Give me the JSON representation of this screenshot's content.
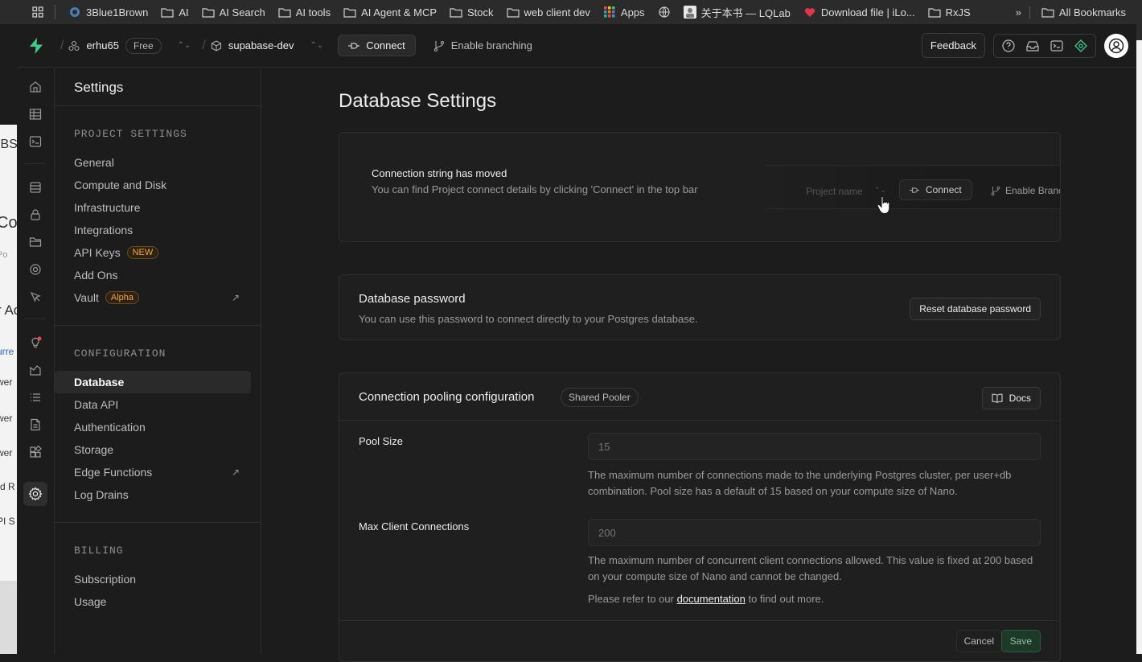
{
  "bookmarks": {
    "items": [
      {
        "label": "3Blue1Brown",
        "icon": "3b1b-icon"
      },
      {
        "label": "AI",
        "icon": "folder-icon"
      },
      {
        "label": "AI Search",
        "icon": "folder-icon"
      },
      {
        "label": "AI tools",
        "icon": "folder-icon"
      },
      {
        "label": "AI Agent & MCP",
        "icon": "folder-icon"
      },
      {
        "label": "Stock",
        "icon": "folder-icon"
      },
      {
        "label": "web client dev",
        "icon": "folder-icon"
      },
      {
        "label": "Apps",
        "icon": "apps-grid-icon"
      },
      {
        "label": "",
        "icon": "globe-icon"
      },
      {
        "label": "关于本书 — LQLab",
        "icon": "avatar-icon"
      },
      {
        "label": "Download file | iLo...",
        "icon": "heart-icon"
      },
      {
        "label": "RxJS",
        "icon": "folder-icon"
      }
    ],
    "more": "»",
    "all": "All Bookmarks"
  },
  "background": {
    "fragments": [
      "IBS",
      "Co",
      "Po",
      "r Ac",
      "urre",
      "wer",
      "wer",
      "wer",
      "rd R",
      "PI S"
    ]
  },
  "topbar": {
    "org": "erhu65",
    "plan": "Free",
    "project": "supabase-dev",
    "connect": "Connect",
    "branching": "Enable branching",
    "feedback": "Feedback"
  },
  "sidebar": {
    "title": "Settings",
    "project_heading": "PROJECT SETTINGS",
    "project_items": [
      "General",
      "Compute and Disk",
      "Infrastructure",
      "Integrations",
      "API Keys",
      "Add Ons",
      "Vault"
    ],
    "api_keys_tag": "NEW",
    "vault_tag": "Alpha",
    "config_heading": "CONFIGURATION",
    "config_items": [
      "Database",
      "Data API",
      "Authentication",
      "Storage",
      "Edge Functions",
      "Log Drains"
    ],
    "billing_heading": "BILLING",
    "billing_items": [
      "Subscription",
      "Usage"
    ],
    "ext_icon": "↗"
  },
  "main": {
    "title": "Database Settings",
    "moved": {
      "title": "Connection string has moved",
      "desc": "You can find Project connect details by clicking 'Connect' in the top bar",
      "demo_project": "Project name",
      "demo_connect": "Connect",
      "demo_branch": "Enable Branching"
    },
    "password": {
      "title": "Database password",
      "desc": "You can use this password to connect directly to your Postgres database.",
      "reset": "Reset database password"
    },
    "pooling": {
      "title": "Connection pooling configuration",
      "badge": "Shared Pooler",
      "docs": "Docs",
      "pool_size_label": "Pool Size",
      "pool_size_value": "15",
      "pool_size_help": "The maximum number of connections made to the underlying Postgres cluster, per user+db combination. Pool size has a default of 15 based on your compute size of Nano.",
      "max_client_label": "Max Client Connections",
      "max_client_value": "200",
      "max_client_help": "The maximum number of concurrent client connections allowed. This value is fixed at 200 based on your compute size of Nano and cannot be changed.",
      "refer_prefix": "Please refer to our ",
      "refer_link": "documentation",
      "refer_suffix": " to find out more.",
      "cancel": "Cancel",
      "save": "Save"
    }
  },
  "colors": {
    "brand": "#3ecf8e",
    "background": "#1c1c1c",
    "card": "#1f1f1f",
    "border": "#2e2e2e",
    "tag": "#f2a546"
  }
}
